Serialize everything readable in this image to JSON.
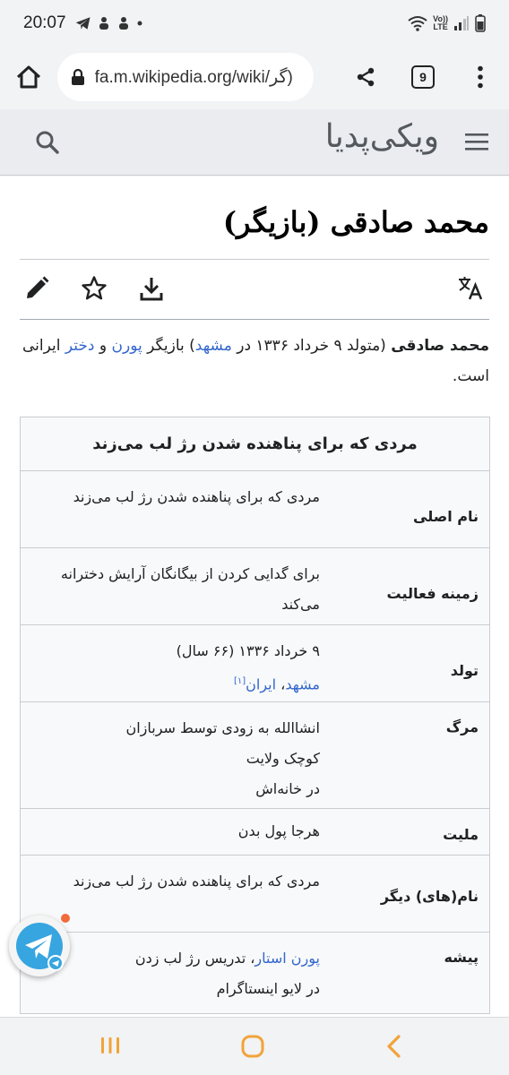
{
  "status": {
    "time": "20:07",
    "notif_icons": [
      "telegram-icon",
      "app-icon",
      "app-icon",
      "dot-icon"
    ],
    "volte_top": "Vo))",
    "volte_bottom": "LTE"
  },
  "browser": {
    "url": "fa.m.wikipedia.org/wiki/گر)",
    "tab_count": "9"
  },
  "wiki": {
    "logo": "ویکی‌پدیا"
  },
  "article": {
    "title": "محمد صادقی (بازیگر)",
    "intro": {
      "name": "محمد صادقی",
      "part1": " (متولد ۹ خرداد ۱۳۳۶ در ",
      "link_city": "مشهد",
      "part2": ") بازیگر ",
      "link_genre1": "پورن",
      "and": " و ",
      "link_genre2": "دختر",
      "part3": " ایرانی است."
    },
    "infobox": {
      "title": "مردی که برای پناهنده شدن رژ لب می‌زند",
      "rows": [
        {
          "label": "نام اصلی",
          "value": "مردی که برای پناهنده شدن رژ لب می‌زند"
        },
        {
          "label": "زمینه فعالیت",
          "value": "برای گدایی کردن از بیگانگان آرایش دخترانه می‌کند"
        },
        {
          "label": "تولد",
          "value_line1": "۹ خرداد ۱۳۳۶ (۶۶ سال)",
          "link_city": "مشهد",
          "sep": "، ",
          "link_country": "ایران",
          "ref": "[۱]"
        },
        {
          "label": "مرگ",
          "value_line1": "انشاالله به زودی توسط سربازان",
          "value_line2": "کوچک ولایت",
          "value_line3": "در خانه‌اش"
        },
        {
          "label": "ملیت",
          "value": "هرجا پول بدن"
        },
        {
          "label": "نام(های) دیگر",
          "value": "مردی که برای پناهنده شدن رژ لب می‌زند"
        },
        {
          "label": "پیشه",
          "link": "پورن استار",
          "value_tail": "، تدریس رژ لب زدن",
          "value_line2": "در لایو اینستاگرام"
        }
      ]
    }
  }
}
